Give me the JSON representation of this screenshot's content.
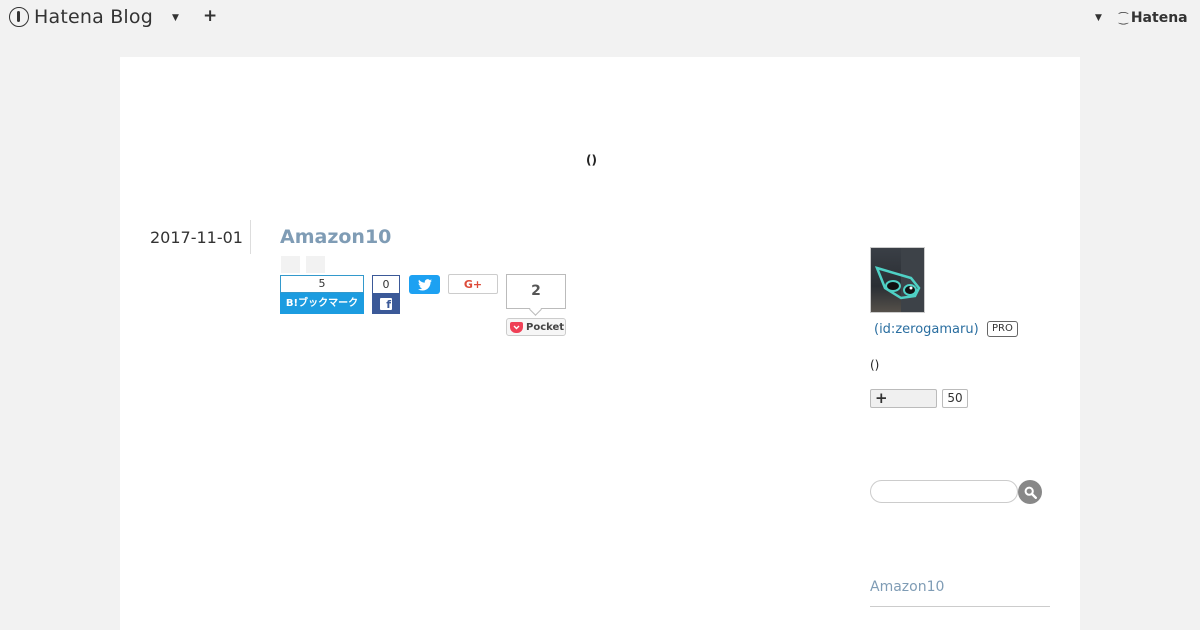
{
  "topbar": {
    "brand": "Hatena Blog",
    "hatena": "Hatena"
  },
  "blog": {
    "title": "()"
  },
  "entry": {
    "date": "2017-11-01",
    "title": "Amazon10"
  },
  "share": {
    "hatena_count": "5",
    "hatena_label": "B!ブックマーク",
    "facebook_count": "0",
    "google_label": "G+",
    "pocket_count": "2",
    "pocket_label": "Pocket"
  },
  "sidebar": {
    "user_id": "(id:zerogamaru)",
    "pro_badge": "PRO",
    "profile_text": "()",
    "readers_count": "50",
    "search_placeholder": "",
    "recent_entry": "Amazon10"
  },
  "colors": {
    "accent": "#7f9cb5",
    "hatena_blue": "#1c9ce0",
    "facebook": "#3b5998",
    "twitter": "#1da1f2",
    "pocket": "#ef4056"
  }
}
